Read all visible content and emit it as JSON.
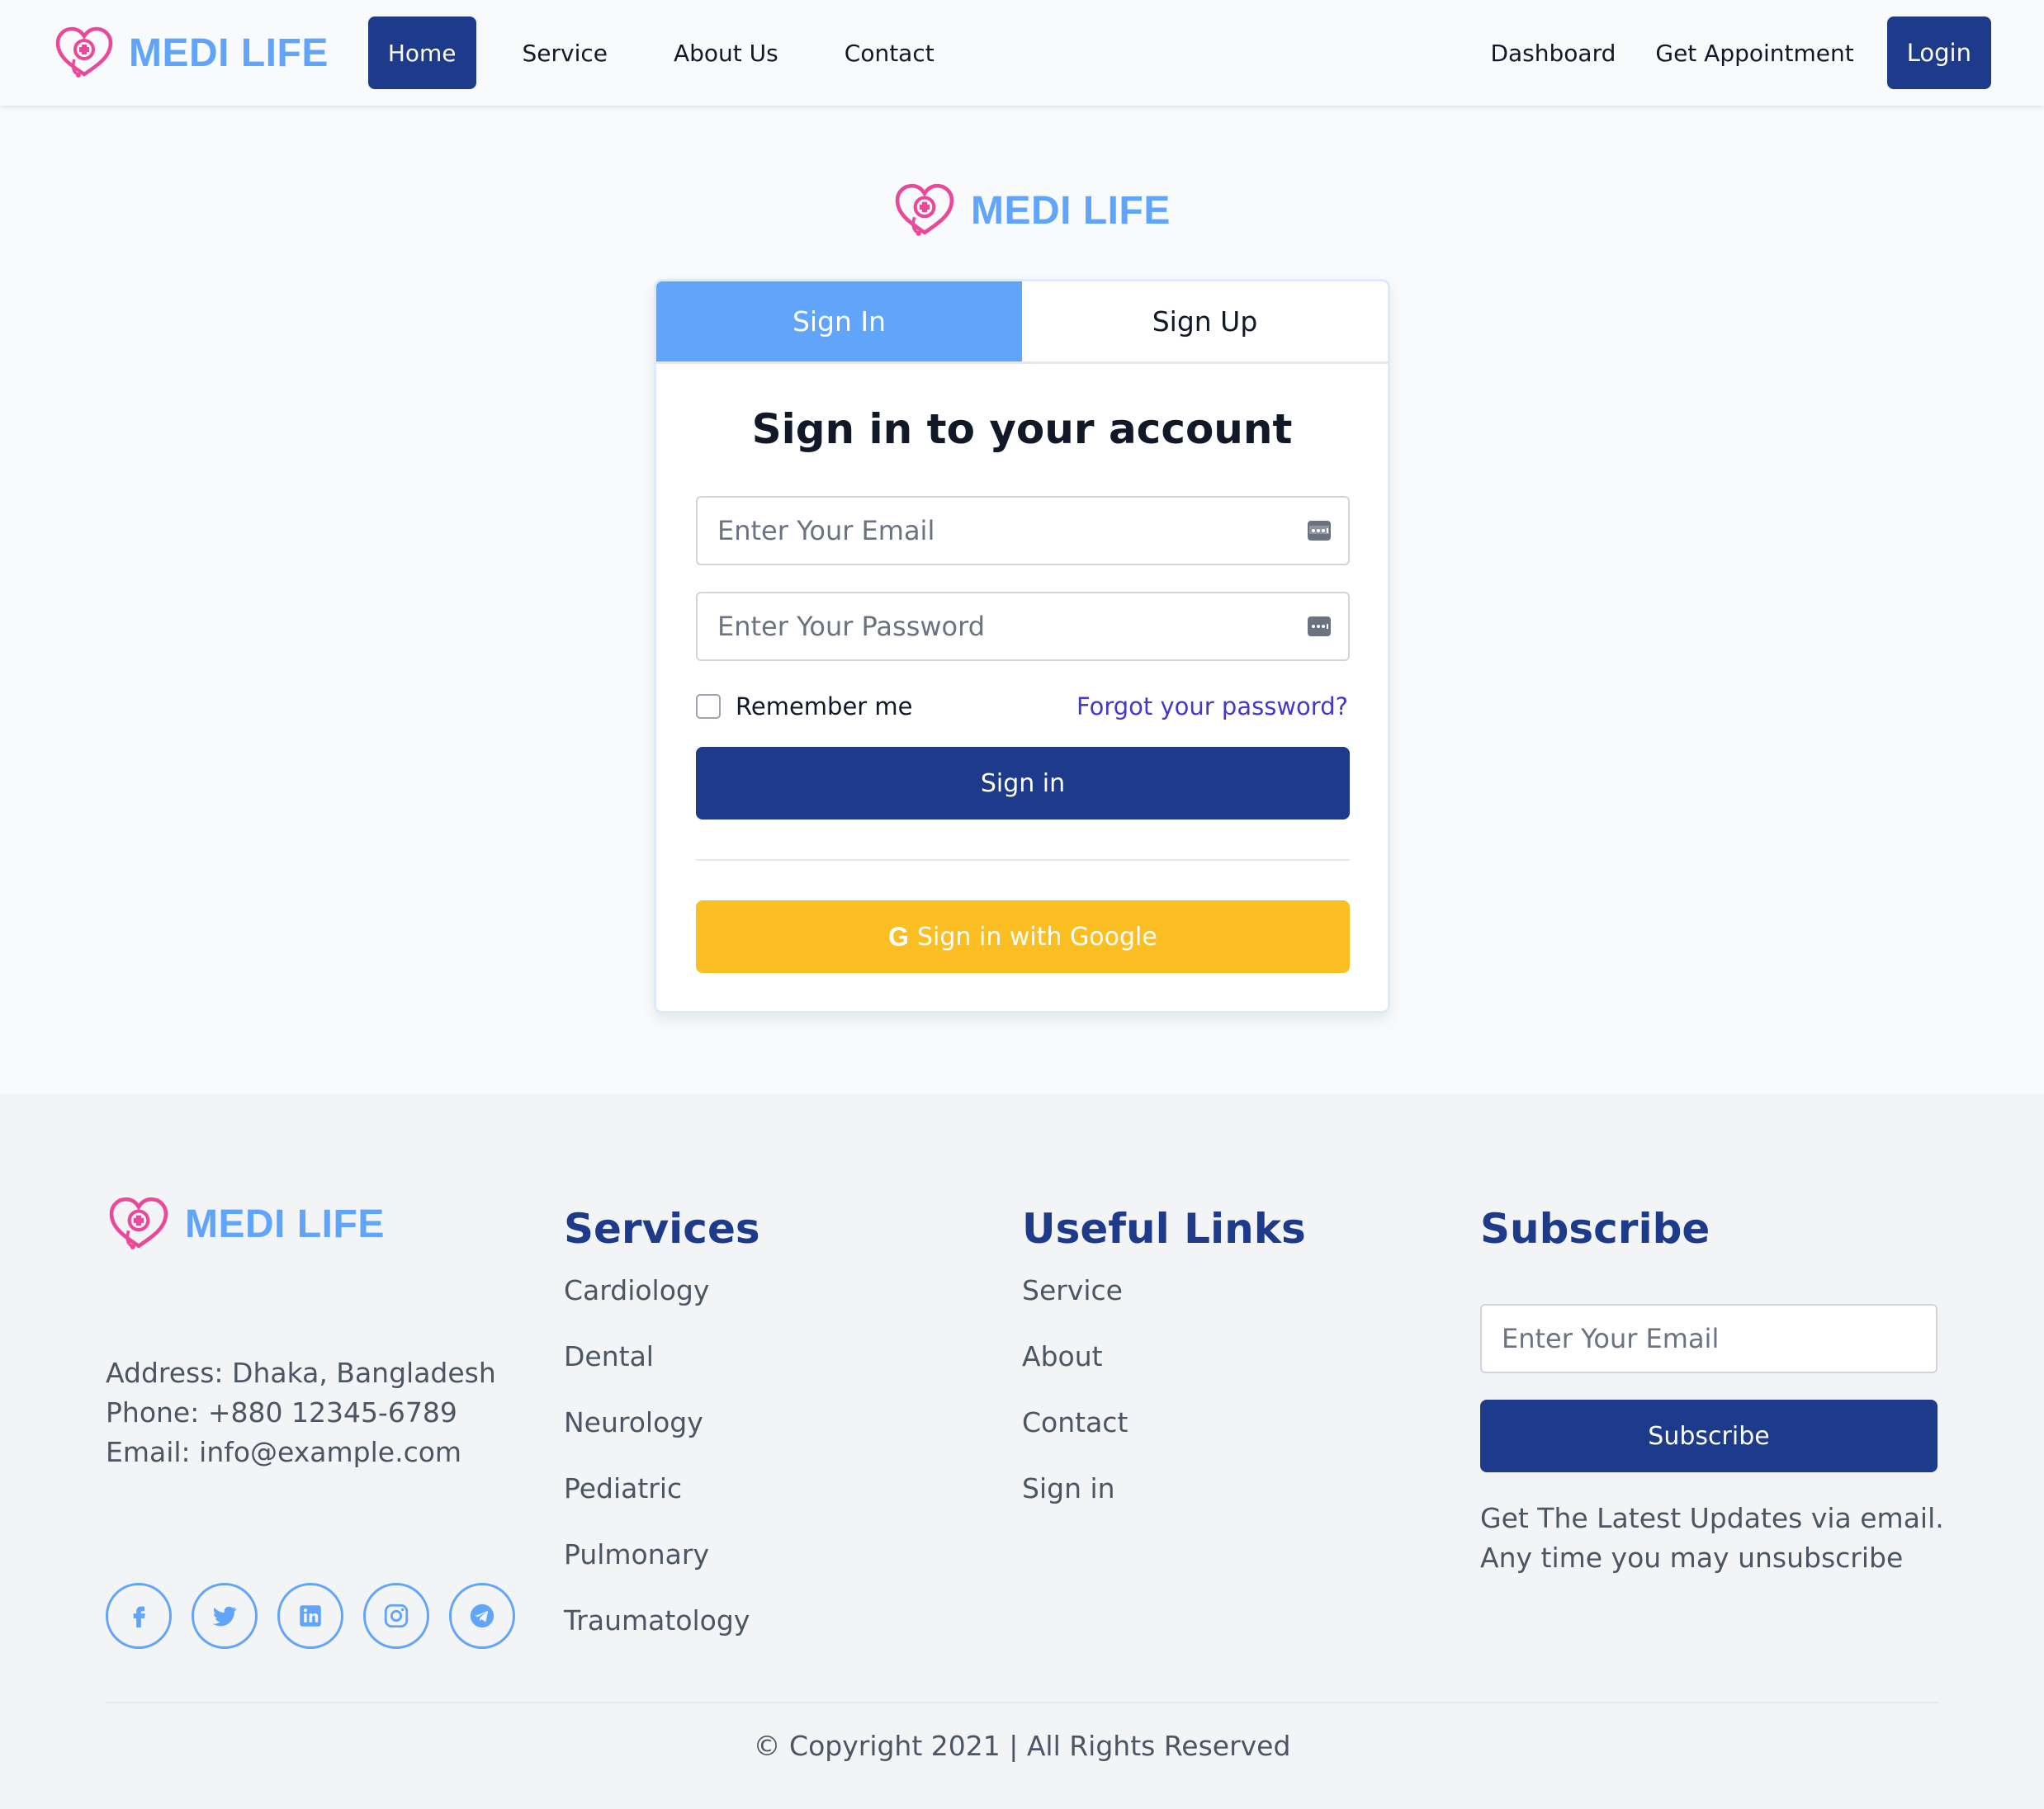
{
  "brand": {
    "name": "MEDI LIFE",
    "logo_icon": "heart-stethoscope-icon",
    "color": "#60a5fa",
    "logo_color": "#ec4899"
  },
  "nav": {
    "links": [
      "Home",
      "Service",
      "About Us",
      "Contact"
    ],
    "active": "Home",
    "right": {
      "dashboard": "Dashboard",
      "appointment": "Get Appointment",
      "login": "Login"
    }
  },
  "auth": {
    "tabs": {
      "signin": "Sign In",
      "signup": "Sign Up"
    },
    "title": "Sign in to your account",
    "email_placeholder": "Enter Your Email",
    "password_placeholder": "Enter Your Password",
    "remember": "Remember me",
    "forgot": "Forgot your password?",
    "signin_button": "Sign in",
    "google_icon": "G",
    "google_button": "Sign in with Google"
  },
  "footer": {
    "contact": {
      "address": "Address: Dhaka, Bangladesh",
      "phone": "Phone: +880 12345-6789",
      "email": "Email: info@example.com"
    },
    "socials": [
      "facebook-icon",
      "twitter-icon",
      "linkedin-icon",
      "instagram-icon",
      "telegram-icon"
    ],
    "services": {
      "heading": "Services",
      "items": [
        "Cardiology",
        "Dental",
        "Neurology",
        "Pediatric",
        "Pulmonary",
        "Traumatology"
      ]
    },
    "links": {
      "heading": "Useful Links",
      "items": [
        "Service",
        "About",
        "Contact",
        "Sign in"
      ]
    },
    "subscribe": {
      "heading": "Subscribe",
      "placeholder": "Enter Your Email",
      "button": "Subscribe",
      "note_line1": "Get The Latest Updates via email.",
      "note_line2": "Any time you may unsubscribe"
    },
    "copyright": "© Copyright 2021 | All Rights Reserved"
  },
  "colors": {
    "primary": "#1e3a8a",
    "accent": "#60a5fa",
    "google": "#fbbf24",
    "link": "#4338ca"
  }
}
